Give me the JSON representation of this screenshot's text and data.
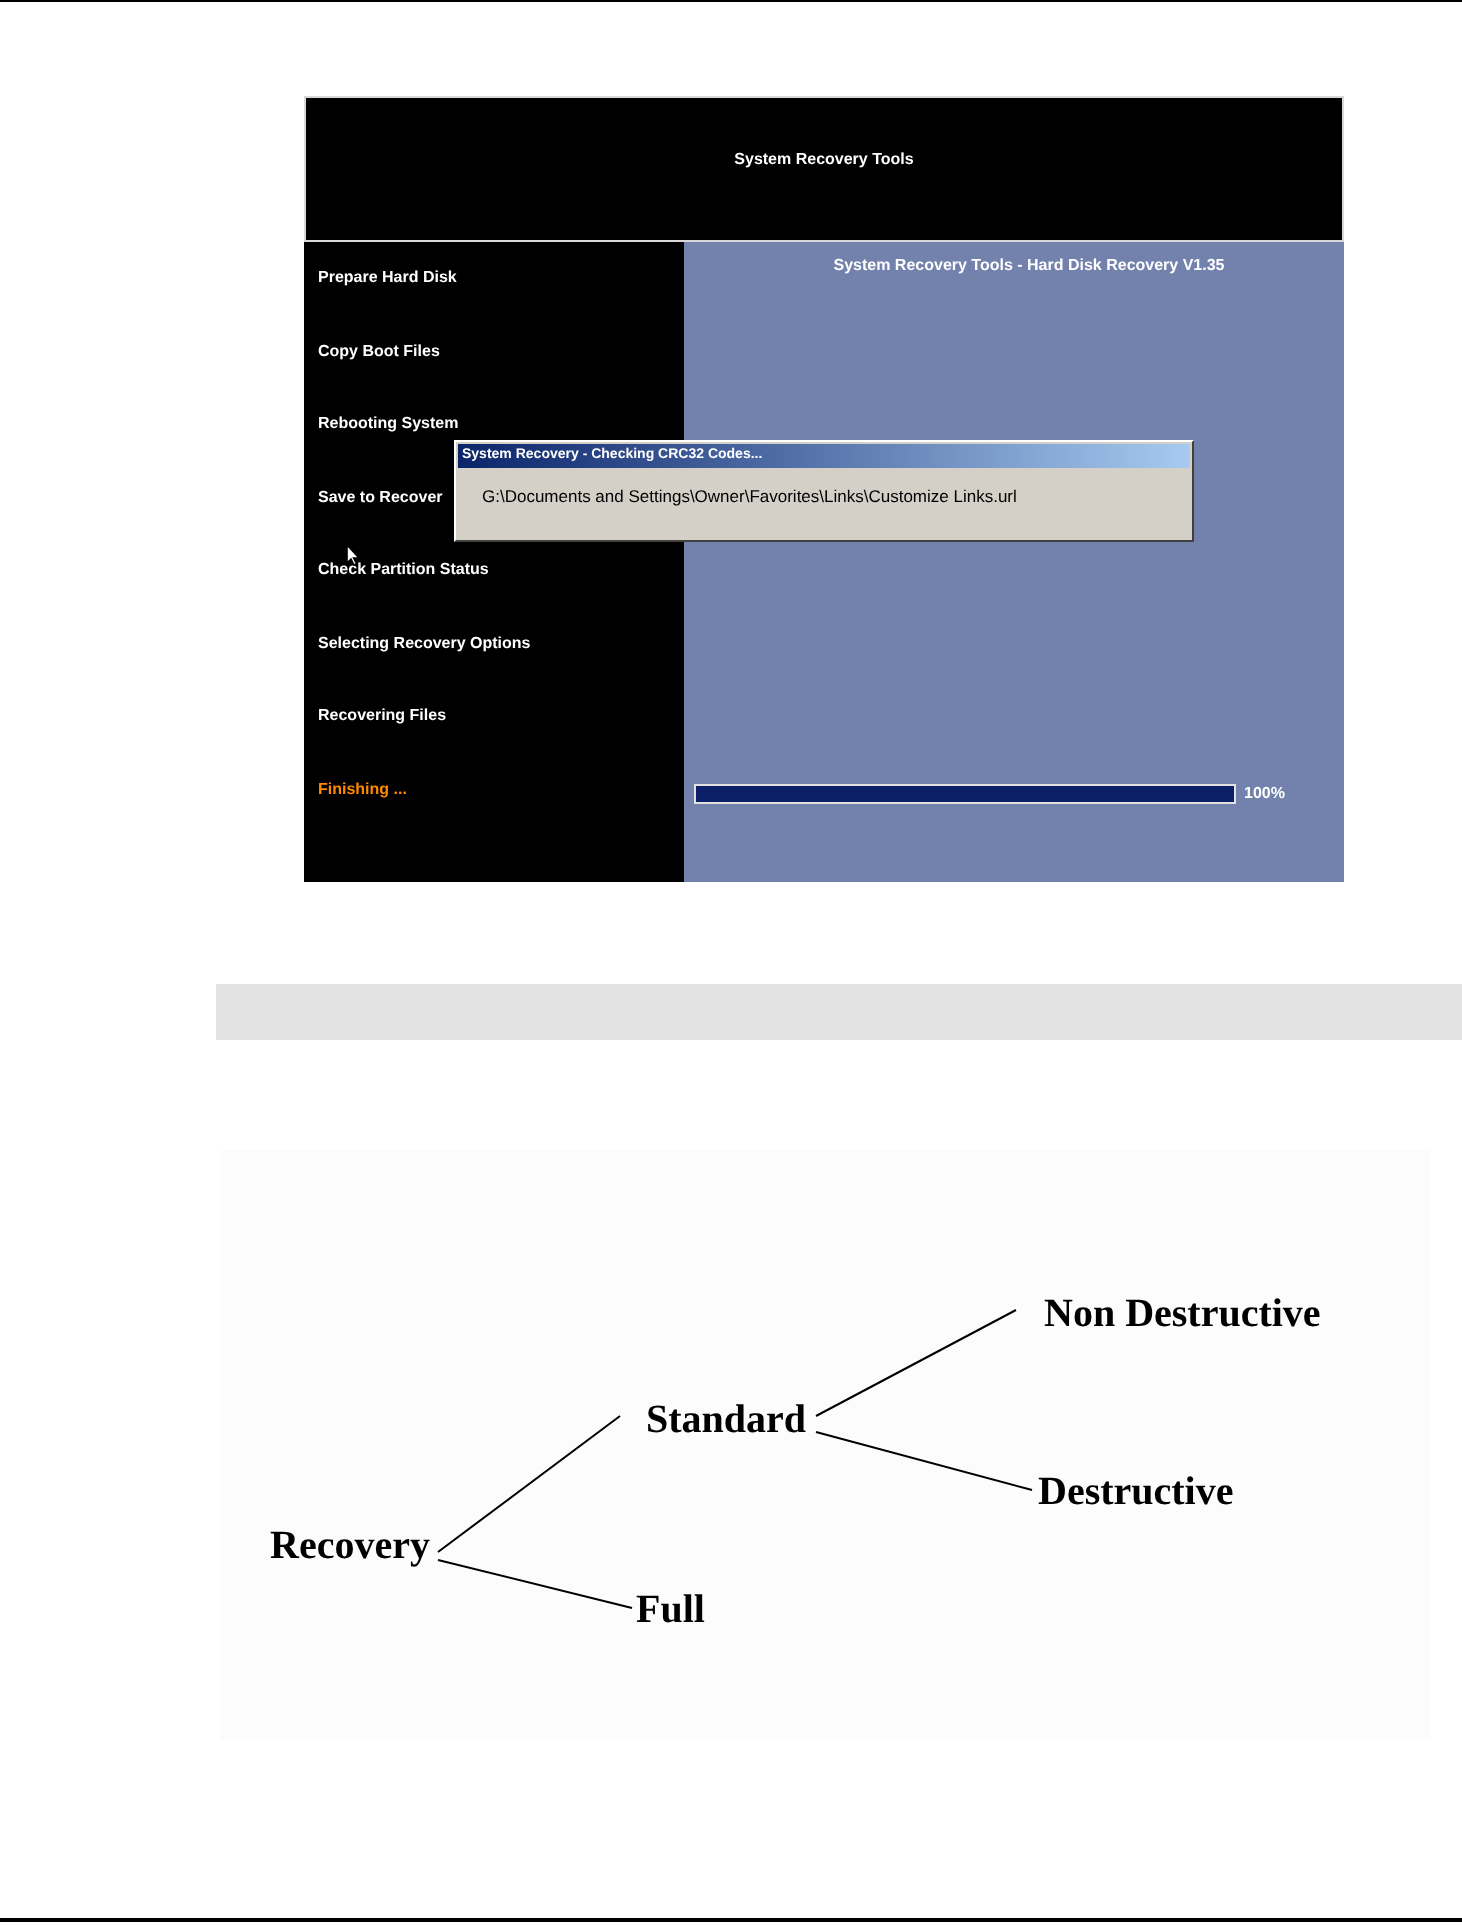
{
  "screenshot": {
    "header_title": "System Recovery Tools",
    "steps": [
      {
        "label": "Prepare Hard Disk",
        "current": false
      },
      {
        "label": "Copy Boot Files",
        "current": false
      },
      {
        "label": "Rebooting System",
        "current": false
      },
      {
        "label": "Save to Recover",
        "current": false
      },
      {
        "label": "Check Partition Status",
        "current": false
      },
      {
        "label": "Selecting Recovery Options",
        "current": false
      },
      {
        "label": "Recovering Files",
        "current": false
      },
      {
        "label": "Finishing ...",
        "current": true
      }
    ],
    "panel_title": "System Recovery Tools - Hard Disk Recovery V1.35",
    "progress": {
      "level": 1,
      "reading": "100%"
    },
    "dialog": {
      "title": "System Recovery - Checking CRC32 Codes...",
      "message": "G:\\Documents and Settings\\Owner\\Favorites\\Links\\Customize Links.url"
    }
  },
  "diagram": {
    "root": {
      "label": "Recovery",
      "children": [
        {
          "label": "Standard",
          "children": [
            {
              "label": "Non Destructive"
            },
            {
              "label": "Destructive"
            }
          ]
        },
        {
          "label": "Full"
        }
      ]
    }
  }
}
